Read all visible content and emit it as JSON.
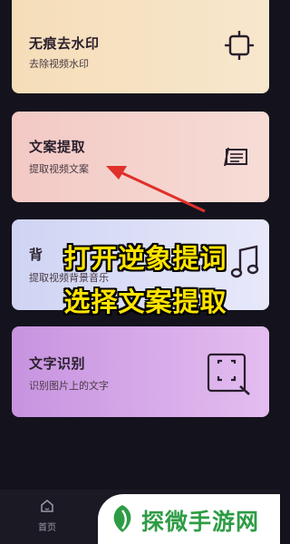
{
  "cards": [
    {
      "title": "无痕去水印",
      "subtitle": "去除视频水印",
      "icon": "crop-frame-icon"
    },
    {
      "title": "文案提取",
      "subtitle": "提取视频文案",
      "icon": "note-pen-icon"
    },
    {
      "title": "背",
      "subtitle": "提取视频背景音乐",
      "icon": "music-note-icon"
    },
    {
      "title": "文字识别",
      "subtitle": "识别图片上的文字",
      "icon": "scan-search-icon"
    }
  ],
  "overlay": {
    "line1": "打开逆象提词",
    "line2": "选择文案提取",
    "color": "#ffe400"
  },
  "tabbar": {
    "home_label": "首页"
  },
  "watermark": {
    "text": "探微手游网",
    "color": "#2e9c45"
  },
  "arrow_color": "#e0302a"
}
